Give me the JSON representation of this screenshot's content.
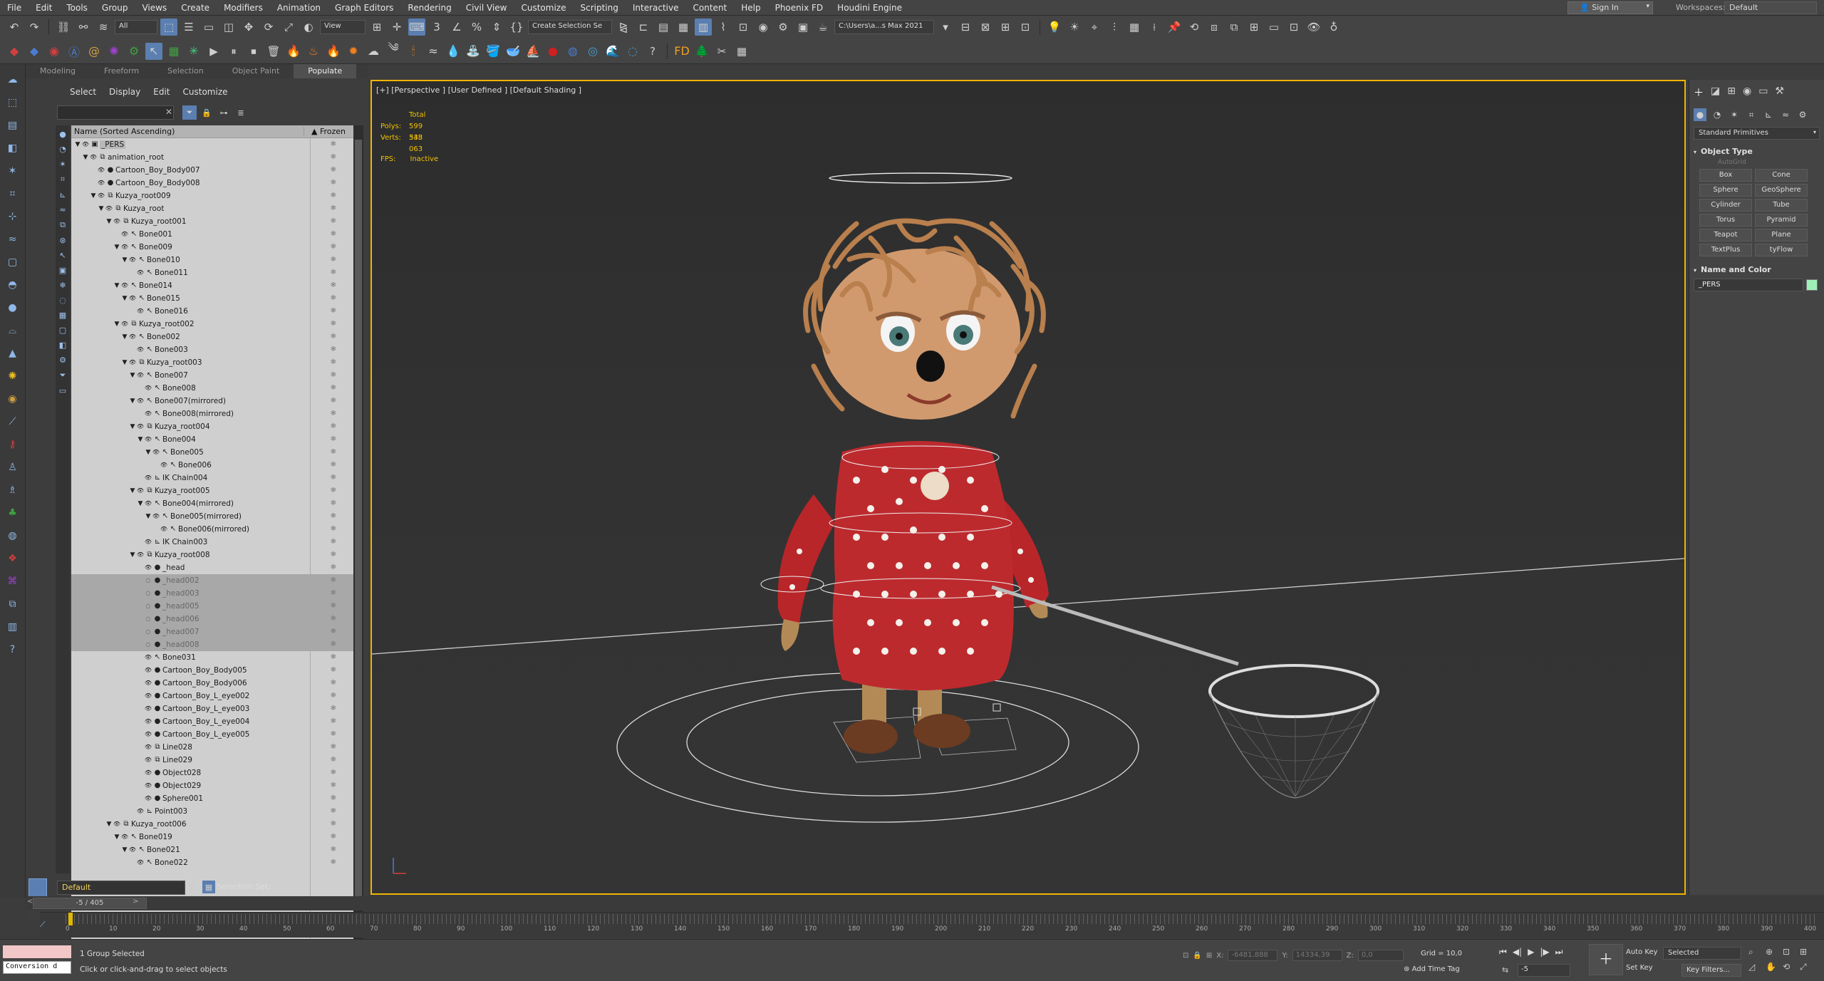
{
  "menu": [
    "File",
    "Edit",
    "Tools",
    "Group",
    "Views",
    "Create",
    "Modifiers",
    "Animation",
    "Graph Editors",
    "Rendering",
    "Civil View",
    "Customize",
    "Scripting",
    "Interactive",
    "Content",
    "Help",
    "Phoenix FD",
    "Houdini Engine"
  ],
  "signin": "Sign In",
  "workspace": {
    "label": "Workspaces:",
    "value": "Default"
  },
  "toolbar": {
    "filter": "All",
    "ref_coord": "View",
    "create_selection_set": "Create Selection Se",
    "project_path": "C:\\Users\\a...s Max 2021"
  },
  "ribbon_tabs": [
    "Modeling",
    "Freeform",
    "Selection",
    "Object Paint",
    "Populate"
  ],
  "explorer": {
    "menu": [
      "Select",
      "Display",
      "Edit",
      "Customize"
    ],
    "header_name": "Name (Sorted Ascending)",
    "header_frozen": "▲ Frozen",
    "rows": [
      {
        "label": "_PERS",
        "depth": 0,
        "toggle": "▼",
        "icon": "▣",
        "pers": true
      },
      {
        "label": "animation_root",
        "depth": 1,
        "toggle": "▼",
        "icon": "⧉"
      },
      {
        "label": "Cartoon_Boy_Body007",
        "depth": 2,
        "toggle": "",
        "icon": "●"
      },
      {
        "label": "Cartoon_Boy_Body008",
        "depth": 2,
        "toggle": "",
        "icon": "●"
      },
      {
        "label": "Kuzya_root009",
        "depth": 2,
        "toggle": "▼",
        "icon": "⧉"
      },
      {
        "label": "Kuzya_root",
        "depth": 3,
        "toggle": "▼",
        "icon": "⧉"
      },
      {
        "label": "Kuzya_root001",
        "depth": 4,
        "toggle": "▼",
        "icon": "⧉"
      },
      {
        "label": "Bone001",
        "depth": 5,
        "toggle": "",
        "icon": "↖"
      },
      {
        "label": "Bone009",
        "depth": 5,
        "toggle": "▼",
        "icon": "↖"
      },
      {
        "label": "Bone010",
        "depth": 6,
        "toggle": "▼",
        "icon": "↖"
      },
      {
        "label": "Bone011",
        "depth": 7,
        "toggle": "",
        "icon": "↖"
      },
      {
        "label": "Bone014",
        "depth": 5,
        "toggle": "▼",
        "icon": "↖"
      },
      {
        "label": "Bone015",
        "depth": 6,
        "toggle": "▼",
        "icon": "↖"
      },
      {
        "label": "Bone016",
        "depth": 7,
        "toggle": "",
        "icon": "↖"
      },
      {
        "label": "Kuzya_root002",
        "depth": 5,
        "toggle": "▼",
        "icon": "⧉"
      },
      {
        "label": "Bone002",
        "depth": 6,
        "toggle": "▼",
        "icon": "↖"
      },
      {
        "label": "Bone003",
        "depth": 7,
        "toggle": "",
        "icon": "↖"
      },
      {
        "label": "Kuzya_root003",
        "depth": 6,
        "toggle": "▼",
        "icon": "⧉"
      },
      {
        "label": "Bone007",
        "depth": 7,
        "toggle": "▼",
        "icon": "↖"
      },
      {
        "label": "Bone008",
        "depth": 8,
        "toggle": "",
        "icon": "↖"
      },
      {
        "label": "Bone007(mirrored)",
        "depth": 7,
        "toggle": "▼",
        "icon": "↖"
      },
      {
        "label": "Bone008(mirrored)",
        "depth": 8,
        "toggle": "",
        "icon": "↖"
      },
      {
        "label": "Kuzya_root004",
        "depth": 7,
        "toggle": "▼",
        "icon": "⧉"
      },
      {
        "label": "Bone004",
        "depth": 8,
        "toggle": "▼",
        "icon": "↖"
      },
      {
        "label": "Bone005",
        "depth": 9,
        "toggle": "▼",
        "icon": "↖"
      },
      {
        "label": "Bone006",
        "depth": 10,
        "toggle": "",
        "icon": "↖"
      },
      {
        "label": "IK Chain004",
        "depth": 8,
        "toggle": "",
        "icon": "⊾"
      },
      {
        "label": "Kuzya_root005",
        "depth": 7,
        "toggle": "▼",
        "icon": "⧉"
      },
      {
        "label": "Bone004(mirrored)",
        "depth": 8,
        "toggle": "▼",
        "icon": "↖"
      },
      {
        "label": "Bone005(mirrored)",
        "depth": 9,
        "toggle": "▼",
        "icon": "↖"
      },
      {
        "label": "Bone006(mirrored)",
        "depth": 10,
        "toggle": "",
        "icon": "↖"
      },
      {
        "label": "IK Chain003",
        "depth": 8,
        "toggle": "",
        "icon": "⊾"
      },
      {
        "label": "Kuzya_root008",
        "depth": 7,
        "toggle": "▼",
        "icon": "⧉"
      },
      {
        "label": "_head",
        "depth": 8,
        "toggle": "",
        "icon": "●"
      },
      {
        "label": "_head002",
        "depth": 8,
        "toggle": "",
        "icon": "●",
        "hidden": true
      },
      {
        "label": "_head003",
        "depth": 8,
        "toggle": "",
        "icon": "●",
        "hidden": true
      },
      {
        "label": "_head005",
        "depth": 8,
        "toggle": "",
        "icon": "●",
        "hidden": true
      },
      {
        "label": "_head006",
        "depth": 8,
        "toggle": "",
        "icon": "●",
        "hidden": true
      },
      {
        "label": "_head007",
        "depth": 8,
        "toggle": "",
        "icon": "●",
        "hidden": true
      },
      {
        "label": "_head008",
        "depth": 8,
        "toggle": "",
        "icon": "●",
        "hidden": true
      },
      {
        "label": "Bone031",
        "depth": 8,
        "toggle": "",
        "icon": "↖"
      },
      {
        "label": "Cartoon_Boy_Body005",
        "depth": 8,
        "toggle": "",
        "icon": "●"
      },
      {
        "label": "Cartoon_Boy_Body006",
        "depth": 8,
        "toggle": "",
        "icon": "●"
      },
      {
        "label": "Cartoon_Boy_L_eye002",
        "depth": 8,
        "toggle": "",
        "icon": "●"
      },
      {
        "label": "Cartoon_Boy_L_eye003",
        "depth": 8,
        "toggle": "",
        "icon": "●"
      },
      {
        "label": "Cartoon_Boy_L_eye004",
        "depth": 8,
        "toggle": "",
        "icon": "●"
      },
      {
        "label": "Cartoon_Boy_L_eye005",
        "depth": 8,
        "toggle": "",
        "icon": "●"
      },
      {
        "label": "Line028",
        "depth": 8,
        "toggle": "",
        "icon": "⧉"
      },
      {
        "label": "Line029",
        "depth": 8,
        "toggle": "",
        "icon": "⧉"
      },
      {
        "label": "Object028",
        "depth": 8,
        "toggle": "",
        "icon": "●"
      },
      {
        "label": "Object029",
        "depth": 8,
        "toggle": "",
        "icon": "●"
      },
      {
        "label": "Sphere001",
        "depth": 8,
        "toggle": "",
        "icon": "●"
      },
      {
        "label": "Point003",
        "depth": 7,
        "toggle": "",
        "icon": "⊾"
      },
      {
        "label": "Kuzya_root006",
        "depth": 4,
        "toggle": "▼",
        "icon": "⧉"
      },
      {
        "label": "Bone019",
        "depth": 5,
        "toggle": "▼",
        "icon": "↖"
      },
      {
        "label": "Bone021",
        "depth": 6,
        "toggle": "▼",
        "icon": "↖"
      },
      {
        "label": "Bone022",
        "depth": 7,
        "toggle": "",
        "icon": "↖"
      }
    ],
    "layer": "Default",
    "selection_set_label": "Selection Set:"
  },
  "viewport": {
    "label": "[+] [Perspective ] [User Defined ] [Default Shading ]",
    "stats_total": "Total",
    "polys_label": "Polys:",
    "polys_value": "599 548",
    "verts_label": "Verts:",
    "verts_value": "333 063",
    "fps_label": "FPS:",
    "fps_value": "Inactive"
  },
  "command_panel": {
    "category": "Standard Primitives",
    "object_type_title": "Object Type",
    "autogrid": "AutoGrid",
    "primitives": [
      "Box",
      "Cone",
      "Sphere",
      "GeoSphere",
      "Cylinder",
      "Tube",
      "Torus",
      "Pyramid",
      "Teapot",
      "Plane",
      "TextPlus",
      "tyFlow"
    ],
    "name_color_title": "Name and Color",
    "name_value": "_PERS",
    "color_swatch": "#9ef0b8"
  },
  "timeline": {
    "frame_indicator": "-5 / 405",
    "tick_labels": [
      "0",
      "10",
      "20",
      "30",
      "40",
      "50",
      "60",
      "70",
      "80",
      "90",
      "100",
      "110",
      "120",
      "130",
      "140",
      "150",
      "160",
      "170",
      "180",
      "190",
      "200",
      "210",
      "220",
      "230",
      "240",
      "250",
      "260",
      "270",
      "280",
      "290",
      "300",
      "310",
      "320",
      "330",
      "340",
      "350",
      "360",
      "370",
      "380",
      "390",
      "400"
    ]
  },
  "status": {
    "maxscript_value": "Conversion d",
    "selection": "1 Group Selected",
    "prompt": "Click or click-and-drag to select objects",
    "x_label": "X:",
    "x_value": "-6481,888",
    "y_label": "Y:",
    "y_value": "14334,39",
    "z_label": "Z:",
    "z_value": "0,0",
    "grid": "Grid = 10,0",
    "time_tag": "Add Time Tag",
    "frame": "-5",
    "auto_key": "Auto Key",
    "set_key": "Set Key",
    "selected": "Selected",
    "key_filters": "Key Filters..."
  }
}
